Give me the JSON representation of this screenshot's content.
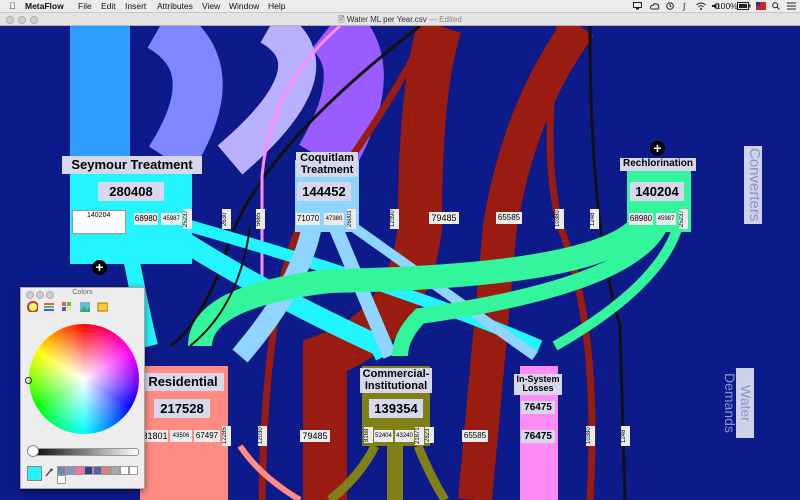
{
  "menubar": {
    "apple_icon": "apple-logo-icon",
    "app_name": "MetaFlow",
    "items": [
      "File",
      "Edit",
      "Insert",
      "Attributes",
      "View",
      "Window",
      "Help"
    ],
    "status_icons": [
      "display-icon",
      "cloud-icon",
      "history-icon",
      "bluetooth-icon",
      "wifi-icon",
      "volume-icon"
    ],
    "battery": "100%",
    "flag_icon": "flag-icon",
    "search_icon": "search-icon",
    "list_icon": "list-icon"
  },
  "window": {
    "title": "Water ML per Year.csv",
    "separator": "—",
    "status": "Edited",
    "document_icon": "document-icon"
  },
  "side_labels": {
    "converters": "Converters",
    "water_demands": "Water Demands"
  },
  "nodes": {
    "seymour": {
      "name": "Seymour Treatment",
      "value": "280408",
      "input_value": "140204",
      "outs": [
        "68980",
        "45987",
        "25237"
      ],
      "color": "#22f5ff"
    },
    "coquitlam": {
      "name": "Coquitlam Treatment",
      "value": "144452",
      "outs": [
        "71070",
        "47380",
        "26001"
      ],
      "color": "#8fd5ff"
    },
    "rechlorination": {
      "name": "Rechlorination",
      "value": "140204",
      "outs": [
        "68980",
        "45987",
        "25237"
      ],
      "color": "#33f59b"
    },
    "residential": {
      "name": "Residential",
      "value": "217528",
      "outs": [
        "81801",
        "43506",
        "67497",
        "12285"
      ],
      "color": "#ff8b83"
    },
    "commercial": {
      "name": "Commercial-Institutional",
      "value": "139354",
      "outs": [
        "8168",
        "52404",
        "43240",
        "21871",
        "2823"
      ],
      "color": "#808016"
    },
    "losses": {
      "name": "In-System Losses",
      "value": "76475",
      "bottom_value": "76475",
      "color": "#ff8cf5"
    }
  },
  "flow_labels": {
    "top": [
      "2630",
      "5665",
      "12390",
      "79485",
      "65585",
      "10380",
      "1248"
    ],
    "bottom": [
      "12030",
      "79485",
      "65585",
      "10380",
      "1248"
    ]
  },
  "colors_panel": {
    "title": "Colors",
    "tabs": [
      "color-wheel-tab-icon",
      "sliders-tab-icon",
      "palettes-tab-icon",
      "image-palettes-tab-icon",
      "crayons-tab-icon"
    ],
    "current_color": "#22f5ff",
    "eyedropper_icon": "eyedropper-icon",
    "swatches": [
      "#6d84c0",
      "#8f8ec9",
      "#ff6f9e",
      "#3a3a88",
      "#5f5c9f",
      "#e07b7b",
      "#aaaaaa",
      "#ffffff",
      "#ffffff",
      "#ffffff"
    ]
  }
}
